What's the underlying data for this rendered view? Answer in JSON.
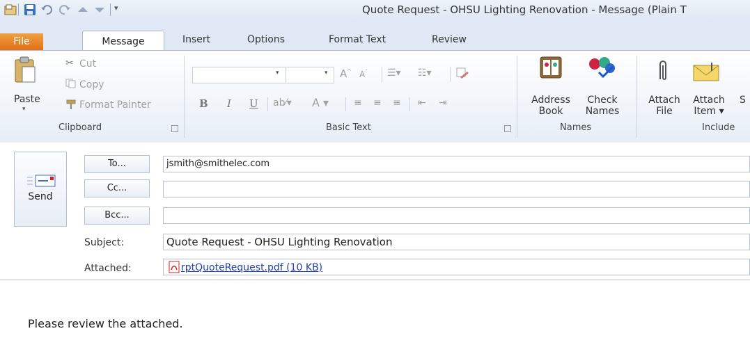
{
  "window": {
    "title": "Quote Request - OHSU Lighting Renovation  -  Message (Plain T"
  },
  "ribbon_tabs": [
    "File",
    "Message",
    "Insert",
    "Options",
    "Format Text",
    "Review"
  ],
  "clipboard": {
    "paste": "Paste",
    "cut": "Cut",
    "copy": "Copy",
    "format_painter": "Format Painter",
    "group": "Clipboard"
  },
  "basic_text": {
    "bold": "B",
    "italic": "I",
    "underline": "U",
    "group": "Basic Text"
  },
  "names": {
    "address_book_1": "Address",
    "address_book_2": "Book",
    "check_names_1": "Check",
    "check_names_2": "Names",
    "group": "Names"
  },
  "include": {
    "attach_file_1": "Attach",
    "attach_file_2": "File",
    "attach_item_1": "Attach",
    "attach_item_2": "Item ▾",
    "group": "Include"
  },
  "compose": {
    "send": "Send",
    "to_button": "To...",
    "cc_button": "Cc...",
    "bcc_button": "Bcc...",
    "to_value": "jsmith@smithelec.com",
    "cc_value": "",
    "bcc_value": "",
    "subject_label": "Subject:",
    "subject_value": "Quote Request - OHSU Lighting Renovation",
    "attached_label": "Attached:",
    "attachment": "rptQuoteRequest.pdf (10 KB)"
  },
  "body": {
    "text": "Please review the attached."
  },
  "colors": {
    "file_tab": "#e0701a",
    "ribbon_bg": "#dfe8f4",
    "link": "#1f3fb0",
    "pdf_red": "#d42020"
  }
}
